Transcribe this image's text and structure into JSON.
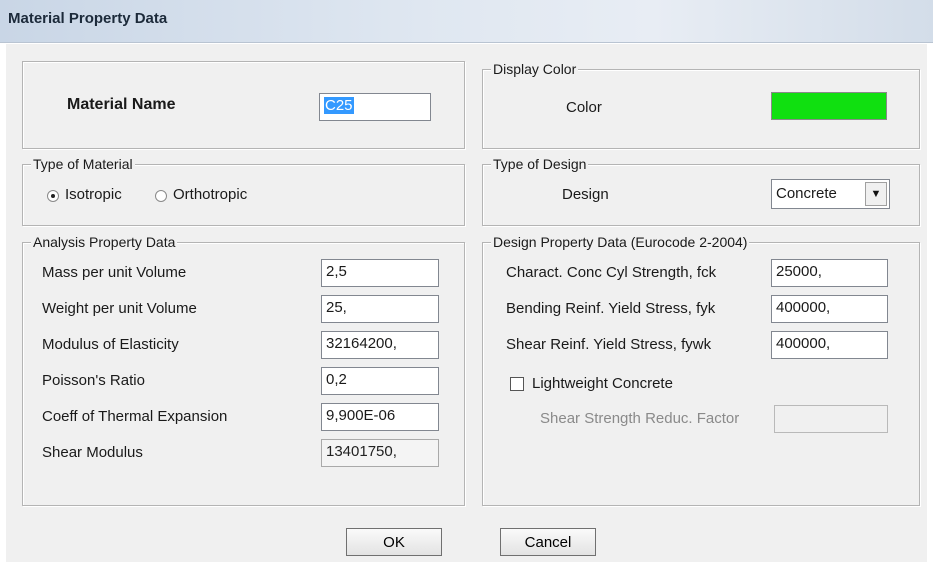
{
  "window": {
    "title": "Material Property Data"
  },
  "material_name": {
    "label": "Material Name",
    "value": "C25"
  },
  "display_color": {
    "group_title": "Display Color",
    "label": "Color",
    "color": "#10e010"
  },
  "type_of_material": {
    "group_title": "Type of Material",
    "options": [
      {
        "label": "Isotropic",
        "selected": true
      },
      {
        "label": "Orthotropic",
        "selected": false
      }
    ]
  },
  "type_of_design": {
    "group_title": "Type of Design",
    "label": "Design",
    "selected": "Concrete"
  },
  "analysis": {
    "group_title": "Analysis Property Data",
    "rows": [
      {
        "label": "Mass per unit Volume",
        "value": "2,5"
      },
      {
        "label": "Weight per unit Volume",
        "value": "25,"
      },
      {
        "label": "Modulus of Elasticity",
        "value": "32164200,"
      },
      {
        "label": "Poisson's Ratio",
        "value": "0,2"
      },
      {
        "label": "Coeff of Thermal Expansion",
        "value": "9,900E-06"
      },
      {
        "label": "Shear Modulus",
        "value": "13401750,"
      }
    ]
  },
  "design": {
    "group_title": "Design Property Data (Eurocode 2-2004)",
    "rows": [
      {
        "label": "Charact. Conc Cyl Strength, fck",
        "value": "25000,"
      },
      {
        "label": "Bending Reinf. Yield Stress, fyk",
        "value": "400000,"
      },
      {
        "label": "Shear Reinf. Yield Stress, fywk",
        "value": "400000,"
      }
    ],
    "lightweight_label": "Lightweight Concrete",
    "lightweight_checked": false,
    "shear_reduc_label": "Shear Strength Reduc. Factor",
    "shear_reduc_value": ""
  },
  "buttons": {
    "ok": "OK",
    "cancel": "Cancel"
  }
}
